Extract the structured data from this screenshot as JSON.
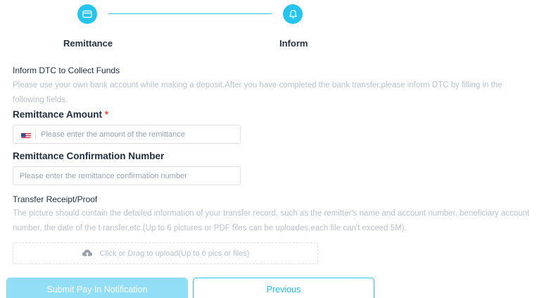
{
  "stepper": {
    "steps": [
      {
        "label": "Remittance",
        "icon": "card-icon"
      },
      {
        "label": "Inform",
        "icon": "bell-icon"
      }
    ]
  },
  "inform": {
    "title": "Inform DTC to Collect Funds",
    "description": "Please use your own bank account while making a deposit.After you have completed the bank transfer,please inform DTC by filling in the following fields."
  },
  "form": {
    "amount": {
      "label": "Remittance Amount",
      "required_mark": "*",
      "currency_icon": "us-flag-icon",
      "placeholder": "Please enter the amount of the remittance",
      "value": ""
    },
    "confirmation": {
      "label": "Remittance Confirmation Number",
      "placeholder": "Please enter the remittance confirmation number",
      "value": ""
    },
    "receipt": {
      "title": "Transfer Receipt/Proof",
      "description": "The picture should contain the detailed information of your transfer record, such as the remitter's name and account number, beneficiary account number, the date of the t ransfer,etc.(Up to 6 pictures or PDF files can be uploades,each file can't exceed 5M).",
      "upload_text": "Click or Drag to upload(Up to 6 pics or files)",
      "upload_icon": "upload-cloud-icon"
    }
  },
  "actions": {
    "submit_label": "Submit Pay In Notification",
    "previous_label": "Previous"
  },
  "colors": {
    "accent": "#27c4f0",
    "submit_disabled": "#93def7",
    "required": "#f0453a",
    "muted_text": "#b9c0cc"
  }
}
